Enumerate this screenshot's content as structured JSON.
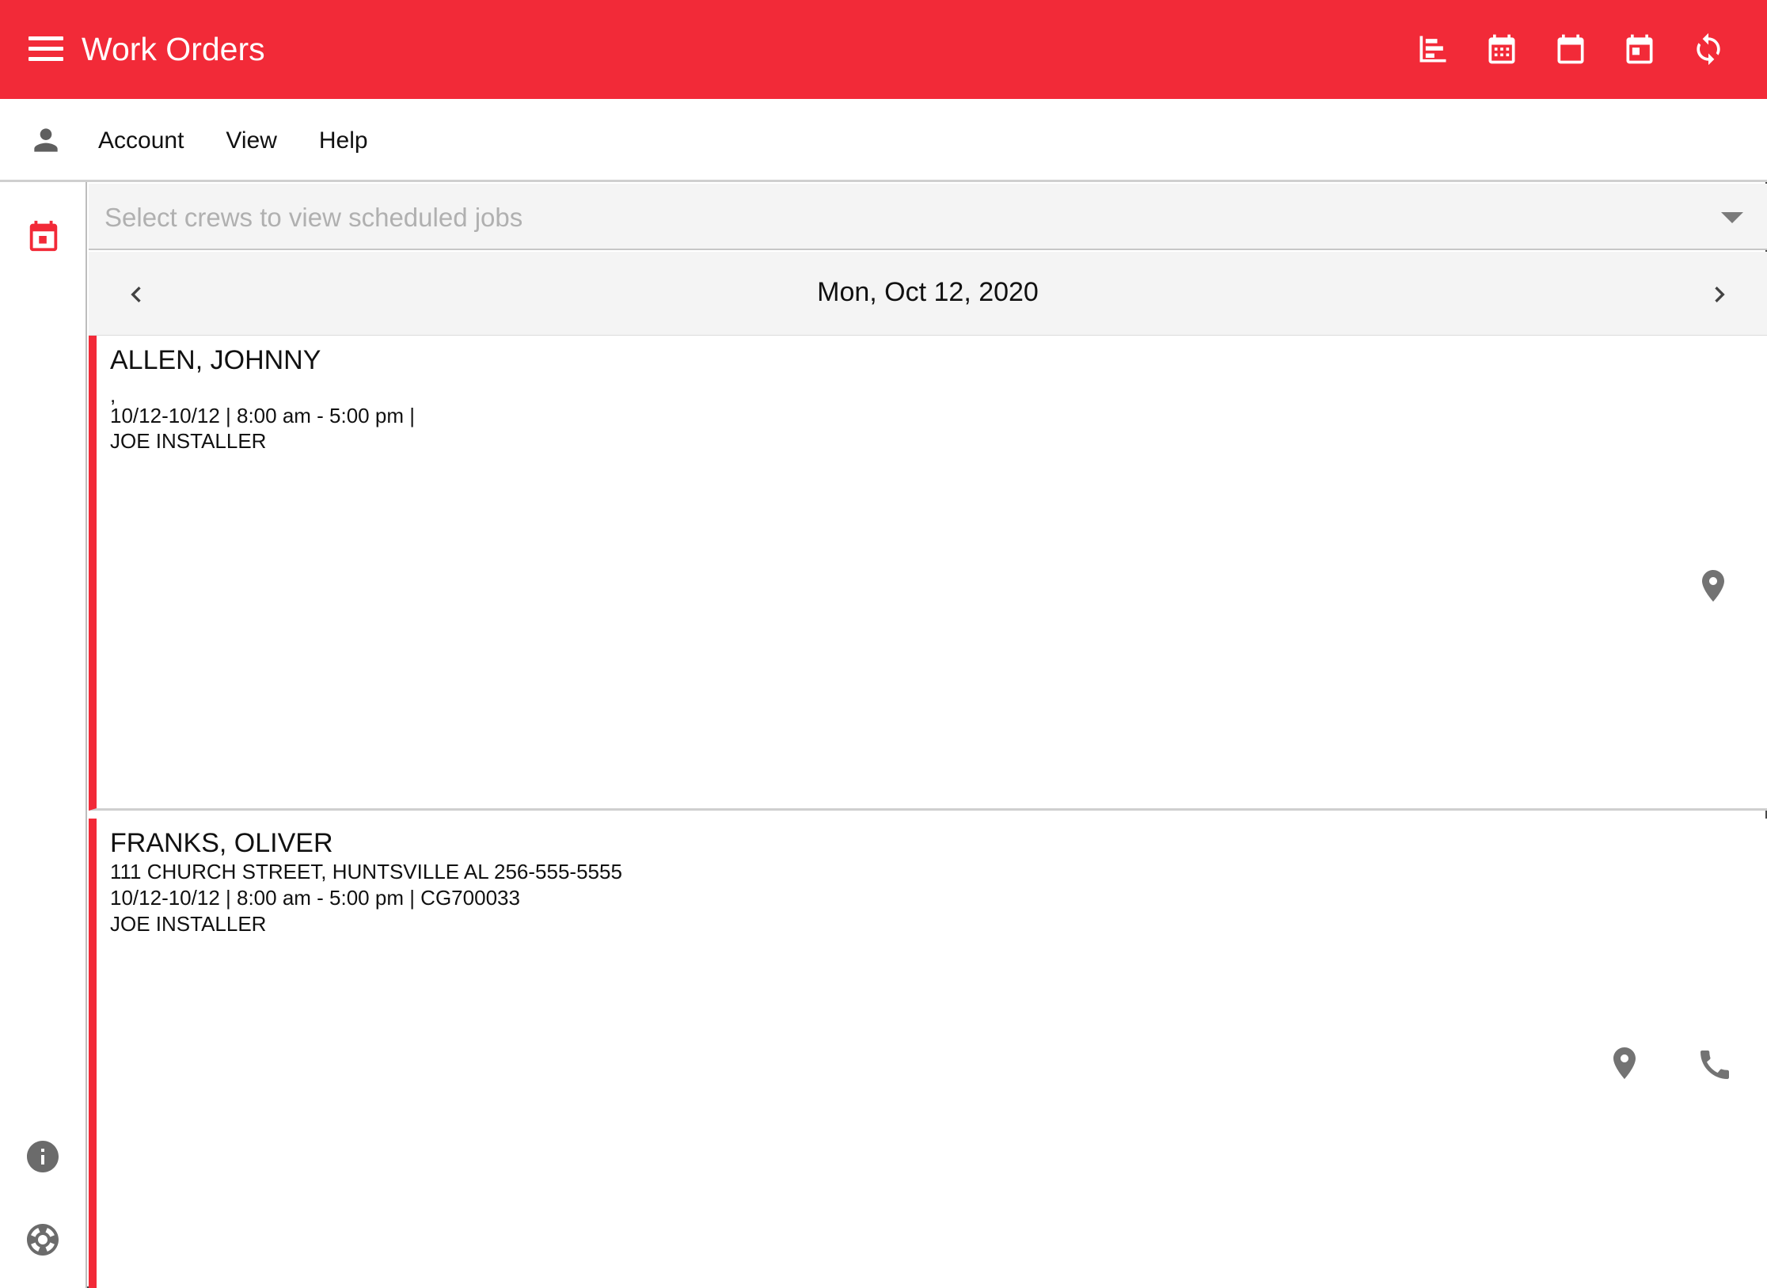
{
  "appbar": {
    "title": "Work Orders",
    "color": "#f22a38",
    "actions": [
      "gantt-icon",
      "calendar-month-icon",
      "calendar-week-icon",
      "calendar-day-icon",
      "sync-icon"
    ]
  },
  "menubar": {
    "items": [
      {
        "label": "Account"
      },
      {
        "label": "View"
      },
      {
        "label": "Help"
      }
    ]
  },
  "crew_select": {
    "placeholder": "Select crews to view scheduled jobs"
  },
  "date_nav": {
    "date": "Mon, Oct 12, 2020"
  },
  "jobs": [
    {
      "customer": "ALLEN, JOHNNY",
      "address": ",",
      "schedule": "10/12-10/12 | 8:00 am - 5:00 pm |",
      "crew": "JOE INSTALLER",
      "actions": [
        "map-pin-icon"
      ]
    },
    {
      "customer": "FRANKS, OLIVER",
      "address": "111 CHURCH STREET, HUNTSVILLE AL 256-555-5555",
      "schedule": "10/12-10/12 | 8:00 am - 5:00 pm | CG700033",
      "crew": "JOE INSTALLER",
      "actions": [
        "map-pin-icon",
        "phone-icon"
      ]
    }
  ]
}
